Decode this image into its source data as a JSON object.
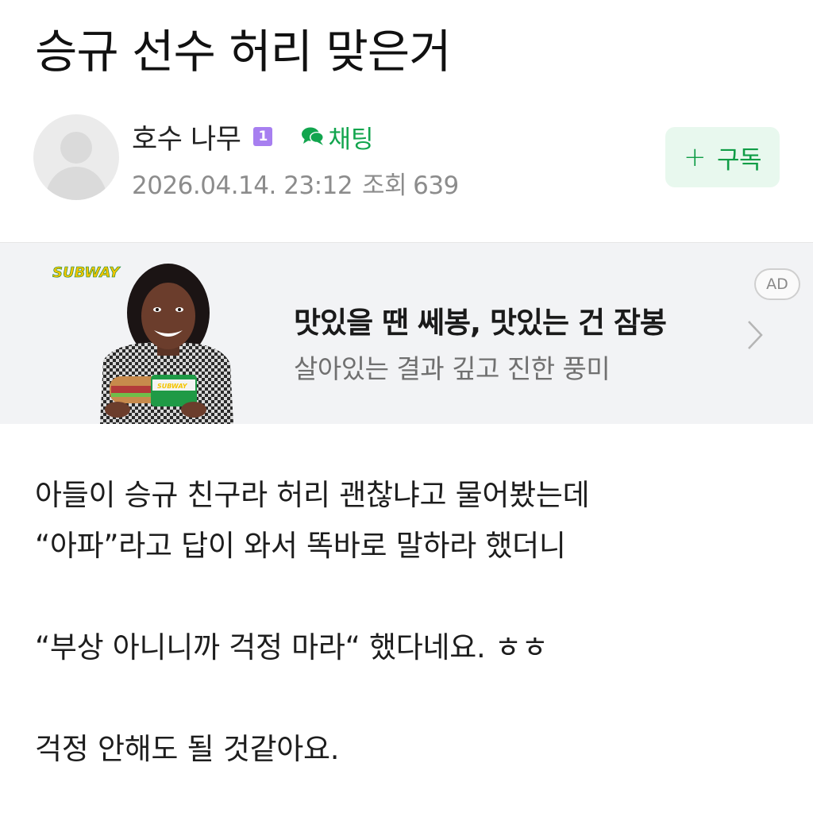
{
  "post": {
    "title": "승규 선수 허리 맞은거"
  },
  "author": {
    "name": "호수 나무",
    "level": "1",
    "chat_label": "채팅",
    "date": "2026.04.14. 23:12",
    "views_label": "조회",
    "views_count": "639",
    "subscribe_label": "구독"
  },
  "ad": {
    "brand": "SUBWAY",
    "headline": "맛있을 땐 쎄봉, 맛있는 건 잠봉",
    "subline": "살아있는 결과 깊고 진한 풍미",
    "badge": "AD"
  },
  "content": {
    "paragraphs": [
      "아들이 승규 친구라 허리 괜찮냐고 물어봤는데",
      "“아파”라고 답이 와서 똑바로 말하라 했더니",
      "",
      "“부상 아니니까 걱정 마라“ 했다네요. ㅎㅎ",
      "",
      "걱정 안해도 될 것같아요."
    ]
  },
  "colors": {
    "accent_green": "#12a54e",
    "subscribe_bg": "#e8f8ee",
    "level_badge": "#a77ff0",
    "ad_bg": "#f2f3f5"
  },
  "icons": {
    "avatar": "default-user-icon",
    "chat": "speech-bubble-icon",
    "ad_arrow": "chevron-right-icon"
  }
}
